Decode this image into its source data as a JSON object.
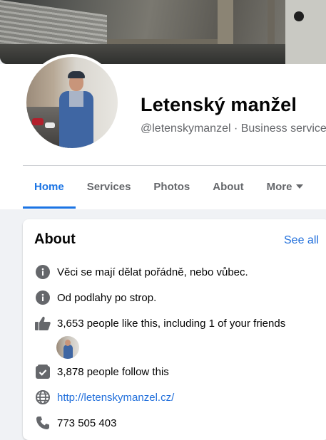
{
  "page": {
    "name": "Letenský manžel",
    "handle": "@letenskymanzel · Business service"
  },
  "tabs": [
    {
      "label": "Home",
      "active": true
    },
    {
      "label": "Services",
      "active": false
    },
    {
      "label": "Photos",
      "active": false
    },
    {
      "label": "About",
      "active": false
    },
    {
      "label": "More",
      "active": false
    }
  ],
  "about": {
    "title": "About",
    "see_all": "See all",
    "items": [
      {
        "icon": "info-icon",
        "text": "Věci se mají dělat pořádně, nebo vůbec."
      },
      {
        "icon": "info-icon",
        "text": "Od podlahy po strop."
      },
      {
        "icon": "thumbs-up-icon",
        "text": "3,653 people like this, including 1 of your friends"
      },
      {
        "icon": "follow-icon",
        "text": "3,878 people follow this"
      },
      {
        "icon": "globe-icon",
        "text": "http://letenskymanzel.cz/"
      },
      {
        "icon": "phone-icon",
        "text": "773 505 403"
      }
    ]
  },
  "colors": {
    "accent": "#1b74e4",
    "link": "#216fdb",
    "muted": "#65676b",
    "background": "#f0f2f5"
  }
}
